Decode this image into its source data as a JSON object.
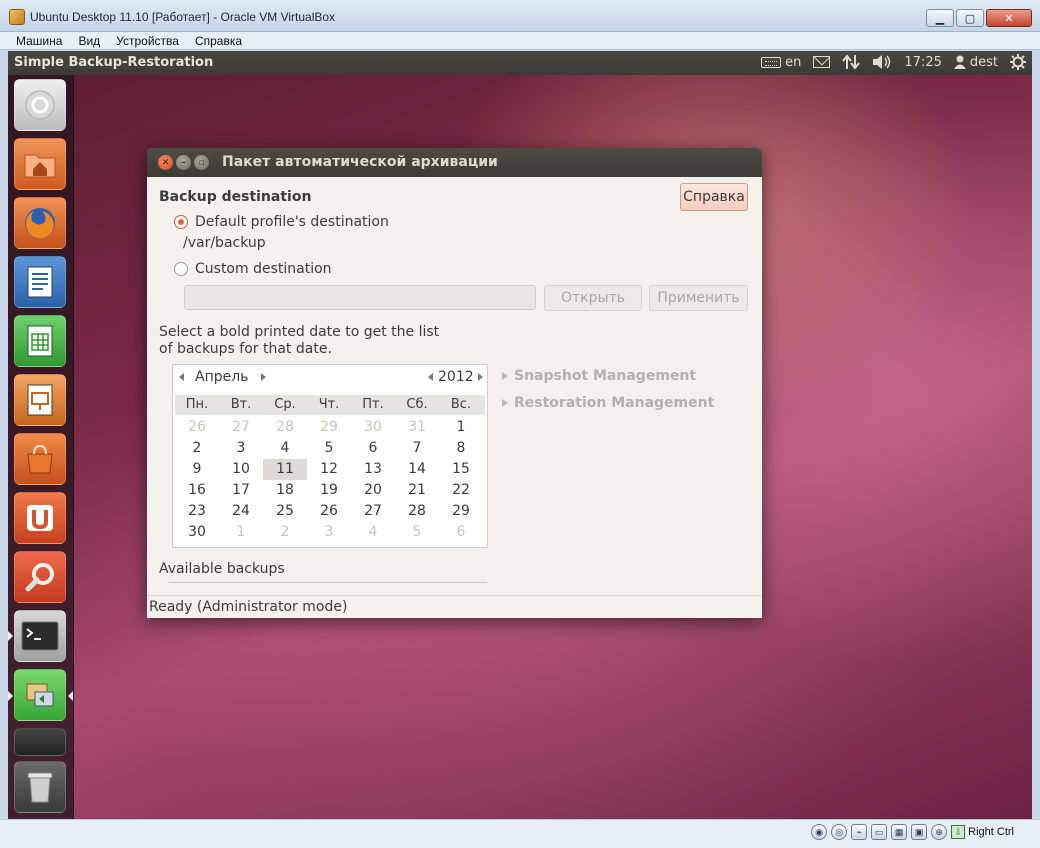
{
  "host": {
    "title": "Ubuntu Desktop 11.10 [Работает] - Oracle VM VirtualBox",
    "menu": [
      "Машина",
      "Вид",
      "Устройства",
      "Справка"
    ],
    "win_controls": {
      "minimize": "▁",
      "maximize": "▢",
      "close": "✕"
    },
    "status_host_key": "Right Ctrl"
  },
  "panel": {
    "app_name": "Simple Backup-Restoration",
    "keyboard": "en",
    "time": "17:25",
    "user": "dest"
  },
  "launcher": {
    "items": [
      {
        "icon": "dash-home-icon",
        "color": "#d8d8d8"
      },
      {
        "icon": "home-folder-icon",
        "color": "#e9773c"
      },
      {
        "icon": "firefox-icon",
        "color": "#e06a1f"
      },
      {
        "icon": "libreoffice-writer-icon",
        "color": "#2f6db5"
      },
      {
        "icon": "libreoffice-calc-icon",
        "color": "#3ca33c"
      },
      {
        "icon": "libreoffice-impress-icon",
        "color": "#d9782c"
      },
      {
        "icon": "software-center-icon",
        "color": "#e0662a"
      },
      {
        "icon": "ubuntu-one-icon",
        "color": "#d9532a"
      },
      {
        "icon": "system-settings-icon",
        "color": "#d94b2c"
      },
      {
        "icon": "terminal-icon",
        "color": "#2a2a2a"
      },
      {
        "icon": "backup-icon",
        "color": "#3fae3f"
      },
      {
        "icon": "workspace-switcher-icon",
        "color": "#2a2a2a"
      },
      {
        "icon": "trash-icon",
        "color": "#555555"
      }
    ]
  },
  "dialog": {
    "title": "Пакет автоматической архивации",
    "help_button": "Справка",
    "section_title": "Backup destination",
    "default_radio": "Default profile's destination",
    "default_path": "/var/backup",
    "custom_radio": "Custom destination",
    "custom_input_value": "",
    "open_button": "Открыть",
    "apply_button": "Применить",
    "hint_line1": "Select a bold printed date to get the list",
    "hint_line2": "of backups for that date.",
    "snapshot_expander": "Snapshot Management",
    "restoration_expander": "Restoration Management",
    "calendar": {
      "month": "Апрель",
      "year": "2012",
      "weekdays": [
        "Пн.",
        "Вт.",
        "Ср.",
        "Чт.",
        "Пт.",
        "Сб.",
        "Вс."
      ],
      "weeks": [
        [
          "26",
          "27",
          "28",
          "29",
          "30",
          "31",
          "1"
        ],
        [
          "2",
          "3",
          "4",
          "5",
          "6",
          "7",
          "8"
        ],
        [
          "9",
          "10",
          "11",
          "12",
          "13",
          "14",
          "15"
        ],
        [
          "16",
          "17",
          "18",
          "19",
          "20",
          "21",
          "22"
        ],
        [
          "23",
          "24",
          "25",
          "26",
          "27",
          "28",
          "29"
        ],
        [
          "30",
          "1",
          "2",
          "3",
          "4",
          "5",
          "6"
        ]
      ],
      "selected": "11"
    },
    "available_label": "Available backups",
    "status_text": "Ready  (Administrator mode)"
  },
  "colors": {
    "accent_orange": "#e0653f",
    "panel_dark": "#3c3b37"
  }
}
